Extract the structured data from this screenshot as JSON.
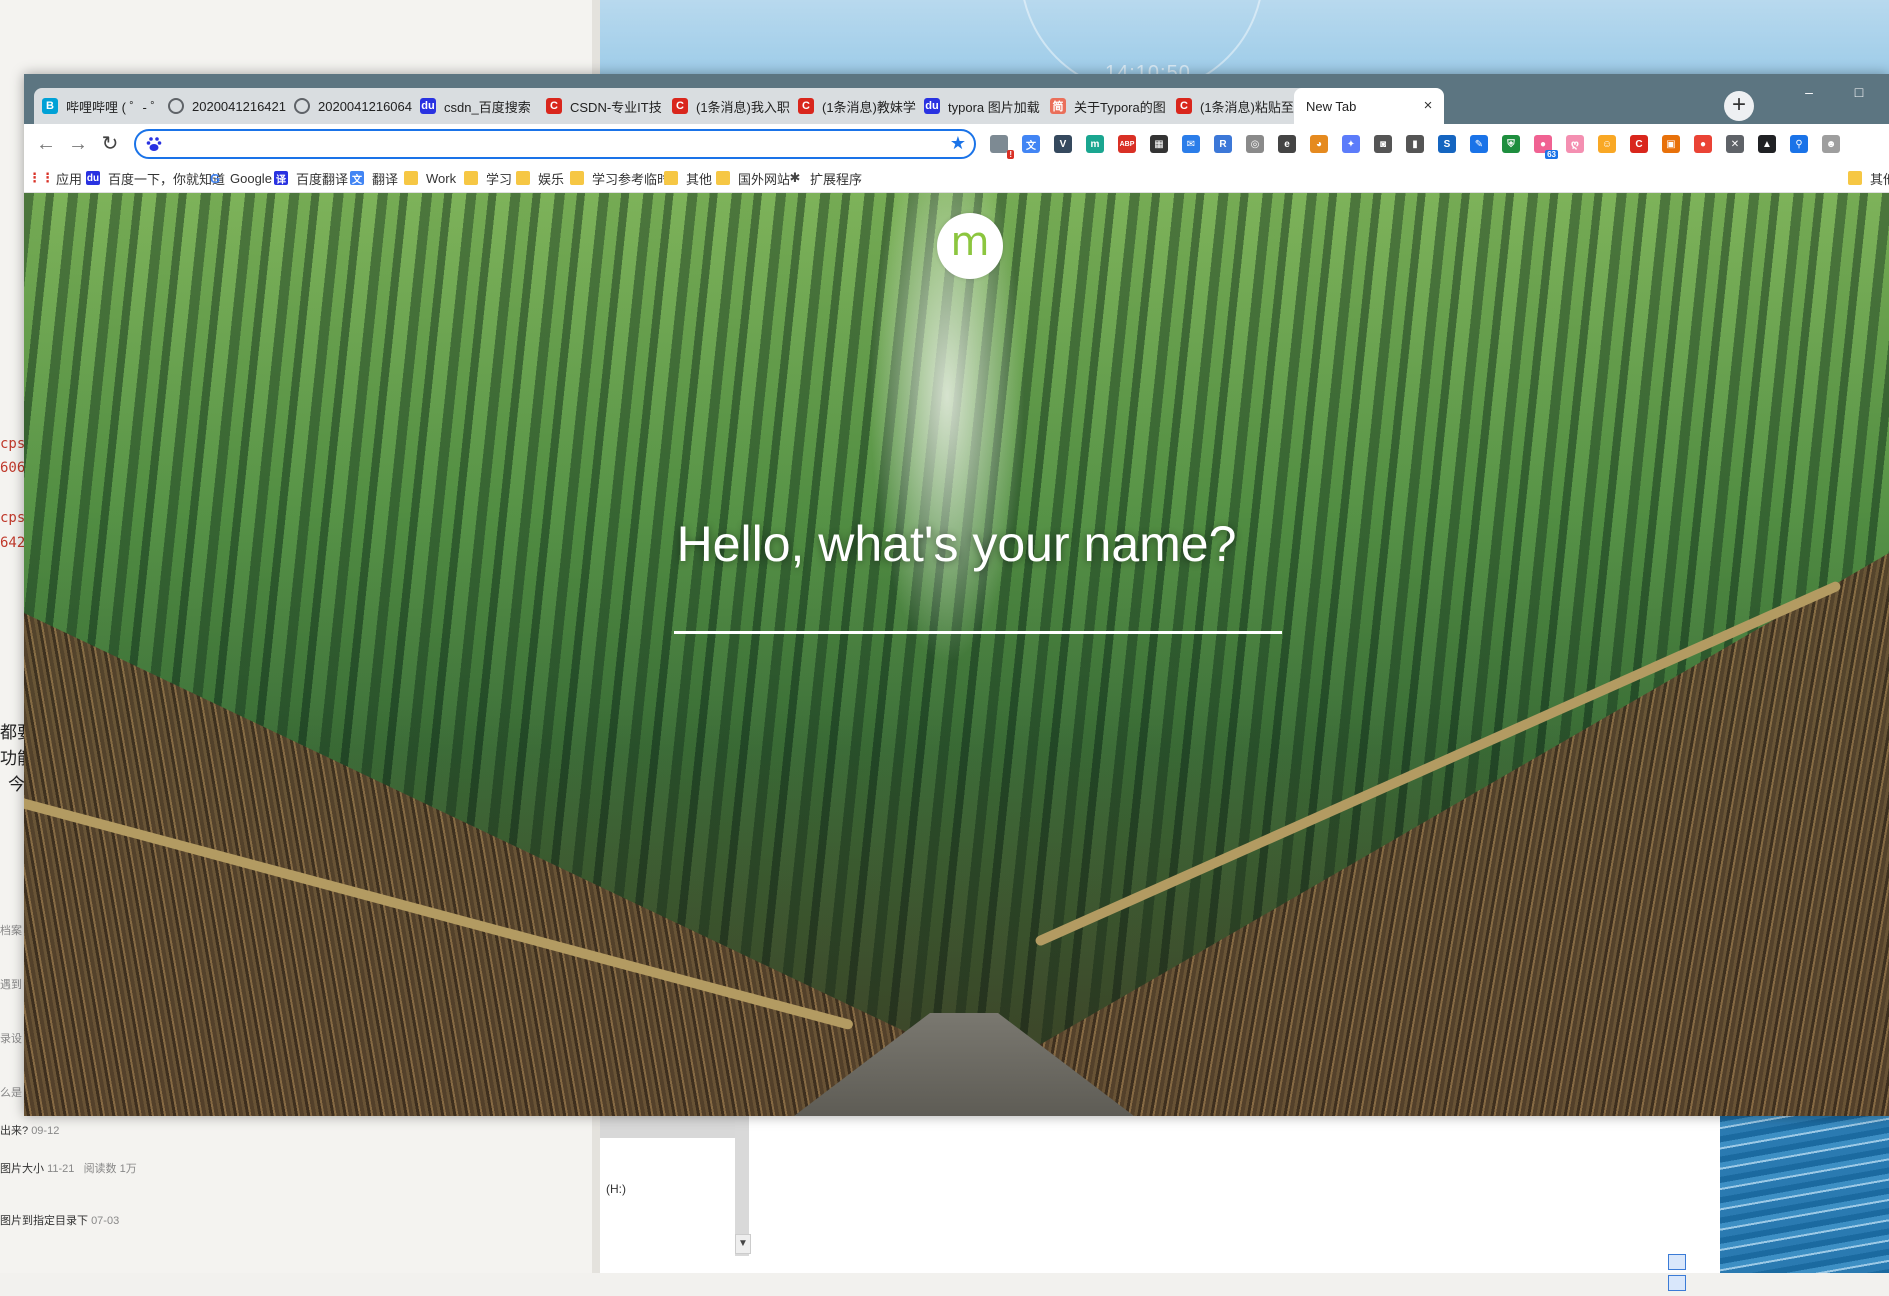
{
  "background": {
    "clock_time": "14:10:50",
    "left_code_lines": [
      "cps",
      "606",
      "cps",
      "642"
    ],
    "left_text_lines": [
      "都要",
      "功能",
      "今"
    ],
    "left_list_stubs": [
      "档案",
      "遇到",
      "录设",
      "么是"
    ],
    "left_articles": [
      {
        "title": "出来?",
        "date": "09-12",
        "reads": ""
      },
      {
        "title": "图片大小",
        "date": "11-21",
        "reads": "阅读数 1万"
      },
      {
        "title": "图片到指定目录下",
        "date": "07-03",
        "reads": ""
      }
    ],
    "drive_label": "(H:)"
  },
  "tabs": [
    {
      "title": "哔哩哔哩 ( ゜- ゜",
      "icon": "bilibili-icon",
      "color": "#00a1d6",
      "glyph": "B"
    },
    {
      "title": "2020041216421",
      "icon": "globe-icon",
      "color": "#5f6368",
      "glyph": ""
    },
    {
      "title": "2020041216064",
      "icon": "globe-icon",
      "color": "#5f6368",
      "glyph": ""
    },
    {
      "title": "csdn_百度搜索",
      "icon": "baidu-icon",
      "color": "#2932e1",
      "glyph": "du"
    },
    {
      "title": "CSDN-专业IT技",
      "icon": "csdn-icon",
      "color": "#d9261c",
      "glyph": "C"
    },
    {
      "title": "(1条消息)我入职",
      "icon": "csdn-icon",
      "color": "#d9261c",
      "glyph": "C"
    },
    {
      "title": "(1条消息)教妹学",
      "icon": "csdn-icon",
      "color": "#d9261c",
      "glyph": "C"
    },
    {
      "title": "typora 图片加载",
      "icon": "baidu-icon",
      "color": "#2932e1",
      "glyph": "du"
    },
    {
      "title": "关于Typora的图",
      "icon": "jianshu-icon",
      "color": "#ea6f5a",
      "glyph": "简"
    },
    {
      "title": "(1条消息)粘贴至",
      "icon": "csdn-icon",
      "color": "#d9261c",
      "glyph": "C"
    },
    {
      "title": "New Tab",
      "icon": "",
      "color": "",
      "glyph": "",
      "active": true
    }
  ],
  "window_controls": {
    "minimize": "–",
    "maximize": "□"
  },
  "omnibox": {
    "value": "",
    "placeholder": ""
  },
  "extensions": [
    {
      "name": "ext-puzzle-icon",
      "color": "#7d8a93",
      "glyph": "",
      "badge": "!"
    },
    {
      "name": "ext-translate-icon",
      "color": "#4285f4",
      "glyph": "文",
      "badge": ""
    },
    {
      "name": "ext-vue-icon",
      "color": "#35495e",
      "glyph": "V",
      "badge": ""
    },
    {
      "name": "ext-momentum-icon",
      "color": "#1aa690",
      "glyph": "m",
      "badge": ""
    },
    {
      "name": "ext-adblock-icon",
      "color": "#d93025",
      "glyph": "ABP",
      "badge": ""
    },
    {
      "name": "ext-qrcode-icon",
      "color": "#333333",
      "glyph": "▦",
      "badge": ""
    },
    {
      "name": "ext-chat-icon",
      "color": "#2b7de9",
      "glyph": "✉",
      "badge": ""
    },
    {
      "name": "ext-reader-icon",
      "color": "#3c78d8",
      "glyph": "R",
      "badge": ""
    },
    {
      "name": "ext-weibo-icon",
      "color": "#8a8a8a",
      "glyph": "◎",
      "badge": ""
    },
    {
      "name": "ext-edge-icon",
      "color": "#444444",
      "glyph": "e",
      "badge": ""
    },
    {
      "name": "ext-owl-icon",
      "color": "#e58a1f",
      "glyph": "◕",
      "badge": ""
    },
    {
      "name": "ext-feather-icon",
      "color": "#5c7cfa",
      "glyph": "✦",
      "badge": ""
    },
    {
      "name": "ext-gamepad-icon",
      "color": "#555555",
      "glyph": "◙",
      "badge": ""
    },
    {
      "name": "ext-bookmark-icon",
      "color": "#555555",
      "glyph": "▮",
      "badge": ""
    },
    {
      "name": "ext-s-icon",
      "color": "#1565c0",
      "glyph": "S",
      "badge": ""
    },
    {
      "name": "ext-pen-icon",
      "color": "#1a73e8",
      "glyph": "✎",
      "badge": ""
    },
    {
      "name": "ext-shield-icon",
      "color": "#1e8e3e",
      "glyph": "⛨",
      "badge": ""
    },
    {
      "name": "ext-cat-icon",
      "color": "#f06292",
      "glyph": "●",
      "badge": "63"
    },
    {
      "name": "ext-pig-icon",
      "color": "#f48fb1",
      "glyph": "ღ",
      "badge": ""
    },
    {
      "name": "ext-emoji-icon",
      "color": "#f9a825",
      "glyph": "☺",
      "badge": ""
    },
    {
      "name": "ext-c-icon",
      "color": "#d9261c",
      "glyph": "C",
      "badge": ""
    },
    {
      "name": "ext-panel-icon",
      "color": "#e8710a",
      "glyph": "▣",
      "badge": ""
    },
    {
      "name": "ext-drop-icon",
      "color": "#ea4335",
      "glyph": "●",
      "badge": ""
    },
    {
      "name": "ext-x-icon",
      "color": "#5f6368",
      "glyph": "✕",
      "badge": ""
    },
    {
      "name": "ext-dark-icon",
      "color": "#202124",
      "glyph": "▲",
      "badge": ""
    },
    {
      "name": "ext-search-icon",
      "color": "#1a73e8",
      "glyph": "⚲",
      "badge": ""
    },
    {
      "name": "ext-avatar-icon",
      "color": "#9e9e9e",
      "glyph": "☻",
      "badge": ""
    }
  ],
  "bookmarks": [
    {
      "label": "应用",
      "icon": "apps-grid-icon",
      "kind": "apps"
    },
    {
      "label": "百度一下，你就知道",
      "icon": "baidu-icon",
      "kind": "baidu"
    },
    {
      "label": "Google",
      "icon": "google-icon",
      "kind": "google"
    },
    {
      "label": "百度翻译",
      "icon": "baidu-translate-icon",
      "kind": "fanyi"
    },
    {
      "label": "翻译",
      "icon": "translate-icon",
      "kind": "translate"
    },
    {
      "label": "Work",
      "icon": "folder-icon",
      "kind": "folder"
    },
    {
      "label": "学习",
      "icon": "folder-icon",
      "kind": "folder"
    },
    {
      "label": "娱乐",
      "icon": "folder-icon",
      "kind": "folder"
    },
    {
      "label": "学习参考临时",
      "icon": "folder-icon",
      "kind": "folder"
    },
    {
      "label": "其他",
      "icon": "folder-icon",
      "kind": "folder"
    },
    {
      "label": "国外网站",
      "icon": "folder-icon",
      "kind": "folder"
    },
    {
      "label": "扩展程序",
      "icon": "puzzle-icon",
      "kind": "puzzle"
    }
  ],
  "other_bookmarks": "其他",
  "momentum": {
    "logo_letter": "m",
    "greeting": "Hello, what's your name?",
    "name_value": ""
  },
  "colors": {
    "titlebar": "#5c7581",
    "omnibox_focus": "#1a73e8",
    "logo_green": "#8cc63f"
  }
}
